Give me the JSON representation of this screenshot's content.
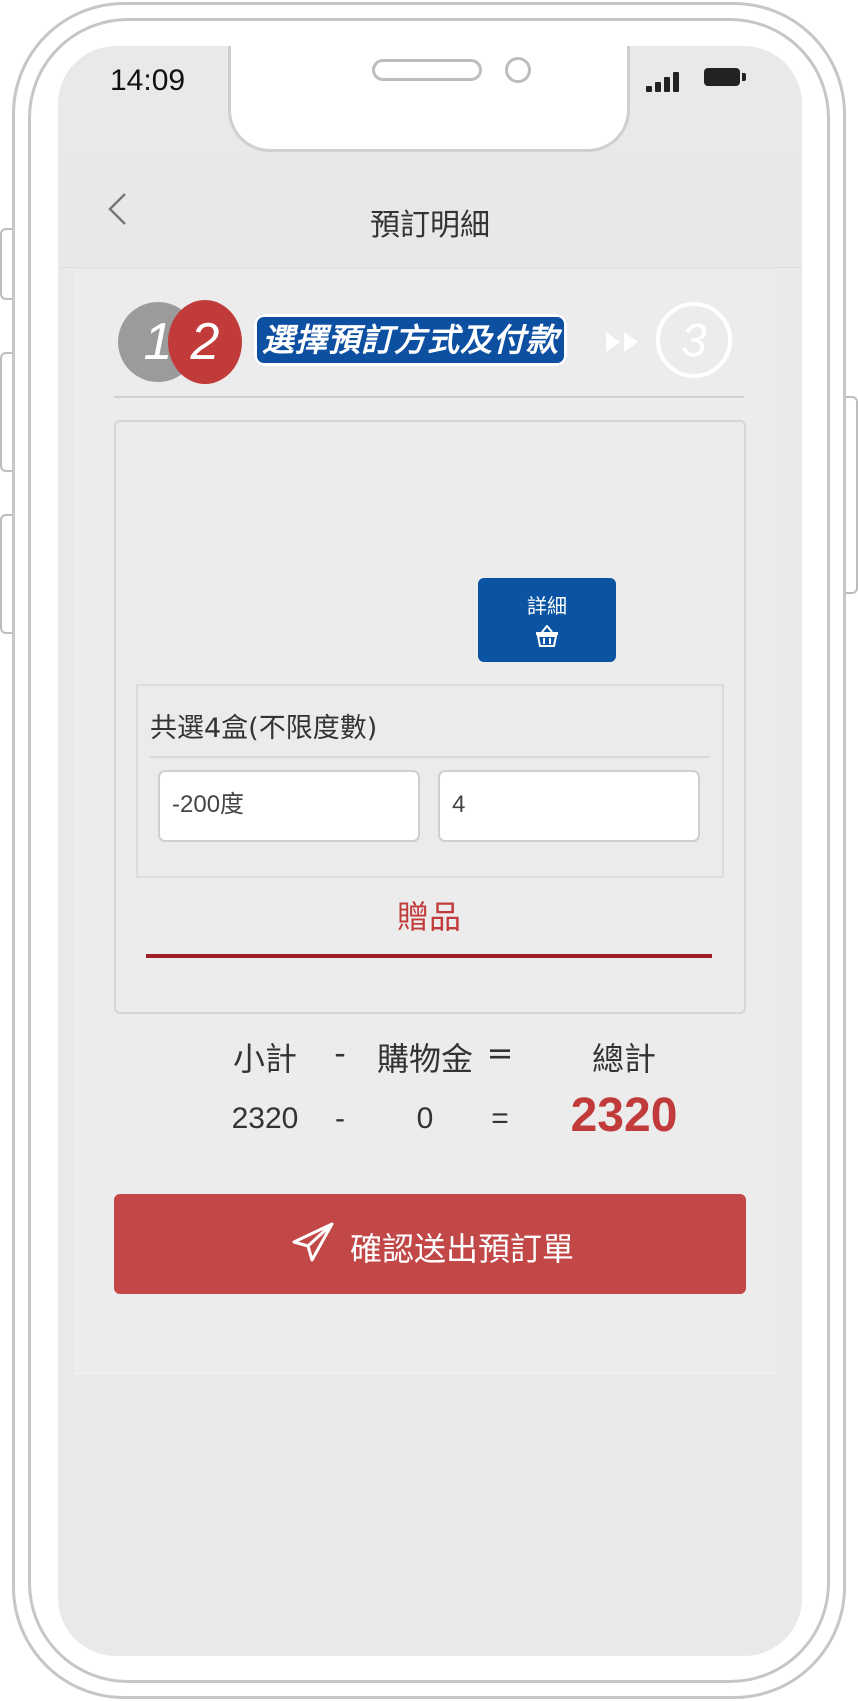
{
  "status_bar": {
    "time": "14:09"
  },
  "header": {
    "title": "預訂明細",
    "back_icon": "chevron-left-icon"
  },
  "steps": {
    "step1": "1",
    "step2": "2",
    "current_label": "選擇預訂方式及付款",
    "step3": "3"
  },
  "card": {
    "detail_button": {
      "label": "詳細",
      "icon": "basket-icon"
    },
    "option": {
      "title": "共選4盒(不限度數)",
      "degree_value": "-200度",
      "quantity_value": "4"
    },
    "gift_tab": "贈品"
  },
  "summary": {
    "labels": {
      "subtotal": "小計",
      "minus": "-",
      "credit": "購物金",
      "equals": "=",
      "total": "總計"
    },
    "values": {
      "subtotal": "2320",
      "minus": "-",
      "credit": "0",
      "equals": "=",
      "total": "2320"
    }
  },
  "submit": {
    "label": "確認送出預訂單",
    "icon": "paper-plane-icon"
  },
  "colors": {
    "brand_red": "#c23b3b",
    "brand_blue": "#0b54a3",
    "screen_bg": "#e9e9e9"
  }
}
